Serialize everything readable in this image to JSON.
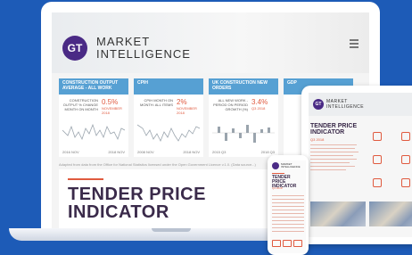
{
  "brand": {
    "logo": "GT",
    "line1": "MARKET",
    "line2": "INTELLIGENCE"
  },
  "laptop": {
    "cards": [
      {
        "header": "CONSTRUCTION OUTPUT AVERAGE - ALL WORK",
        "desc": "CONSTRUCTION OUTPUT % CHANGE MONTH ON MONTH",
        "value": "0.5%",
        "sub": "NOVEMBER 2018",
        "x_start": "2016 NOV",
        "x_end": "2018 NOV"
      },
      {
        "header": "CPIH",
        "desc": "CPIH MONTH ON MONTH: ALL ITEMS",
        "value": "2%",
        "sub": "NOVEMBER 2018",
        "x_start": "2008 NOV",
        "x_end": "2018 NOV"
      },
      {
        "header": "UK CONSTRUCTION NEW ORDERS",
        "desc": "ALL NEW WORK - PERIOD ON PERIOD GROWTH (%)",
        "value": "3.4%",
        "sub": "Q3 2018",
        "x_start": "2015 Q3",
        "x_end": "2018 Q3"
      },
      {
        "header": "GDP",
        "desc": "",
        "value": "",
        "sub": "",
        "x_start": "",
        "x_end": ""
      }
    ],
    "source": "Adapted from data from the Office for National Statistics licensed under the Open Government Licence v.1.0. (Data source...)",
    "tender_title": "TENDER PRICE INDICATOR"
  },
  "tablet": {
    "brand_line1": "MARKET",
    "brand_line2": "INTELLIGENCE",
    "title": "TENDER PRICE INDICATOR",
    "quarter": "Q3 2018",
    "grid": [
      "",
      "",
      "",
      "",
      "",
      ""
    ]
  },
  "phone": {
    "brand_line1": "MARKET",
    "brand_line2": "INTELLIGENCE",
    "title": "TENDER PRICE INDICATOR",
    "quarter": "Q3 2018"
  }
}
